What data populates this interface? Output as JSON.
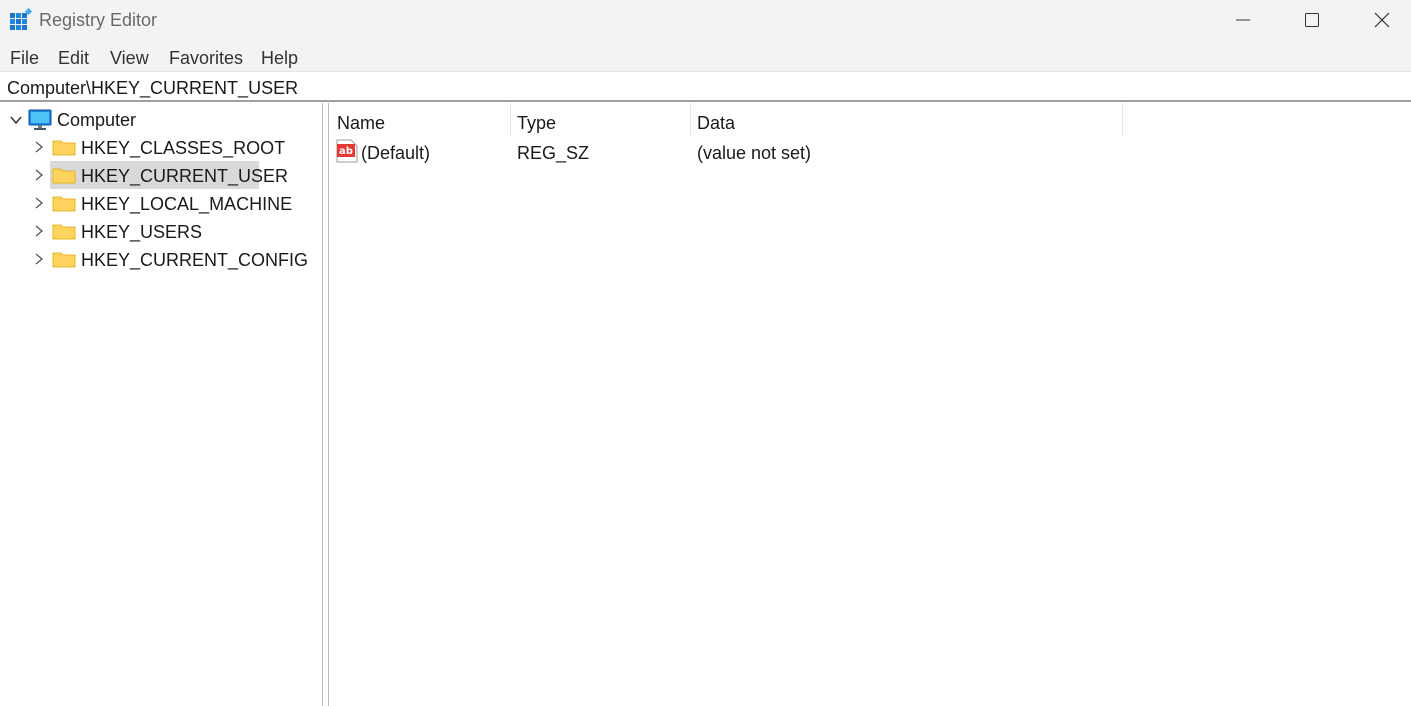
{
  "window": {
    "title": "Registry Editor"
  },
  "menu": [
    {
      "label": "File"
    },
    {
      "label": "Edit"
    },
    {
      "label": "View"
    },
    {
      "label": "Favorites"
    },
    {
      "label": "Help"
    }
  ],
  "address": {
    "path": "Computer\\HKEY_CURRENT_USER"
  },
  "tree": {
    "root": {
      "label": "Computer",
      "expanded": true
    },
    "keys": [
      {
        "label": "HKEY_CLASSES_ROOT",
        "selected": false
      },
      {
        "label": "HKEY_CURRENT_USER",
        "selected": true
      },
      {
        "label": "HKEY_LOCAL_MACHINE",
        "selected": false
      },
      {
        "label": "HKEY_USERS",
        "selected": false
      },
      {
        "label": "HKEY_CURRENT_CONFIG",
        "selected": false
      }
    ]
  },
  "values_table": {
    "columns": [
      "Name",
      "Type",
      "Data"
    ],
    "rows": [
      {
        "icon": "string-value-icon",
        "name": "(Default)",
        "type": "REG_SZ",
        "data": "(value not set)"
      }
    ]
  },
  "colors": {
    "titlebar": "#f3f3f3",
    "selection": "#d9d9d9",
    "folder": "#ffd35c",
    "accent": "#1e88e5"
  }
}
